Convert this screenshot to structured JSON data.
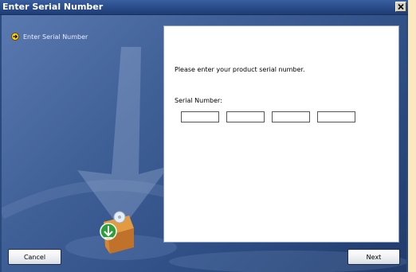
{
  "window": {
    "title": "Enter Serial Number"
  },
  "sidebar": {
    "steps": [
      {
        "label": "Enter Serial Number",
        "icon": "arrow-right-circle-icon",
        "active": true
      }
    ]
  },
  "panel": {
    "prompt": "Please enter your product serial number.",
    "serial_label": "Serial Number:",
    "serial_fields": [
      {
        "value": ""
      },
      {
        "value": ""
      },
      {
        "value": ""
      },
      {
        "value": ""
      }
    ]
  },
  "buttons": {
    "cancel": "Cancel",
    "next": "Next"
  },
  "colors": {
    "titlebar": "#284b89",
    "background": "#2d4c82",
    "page_margin": "#fce8bf",
    "step_icon": "#ffd200"
  }
}
